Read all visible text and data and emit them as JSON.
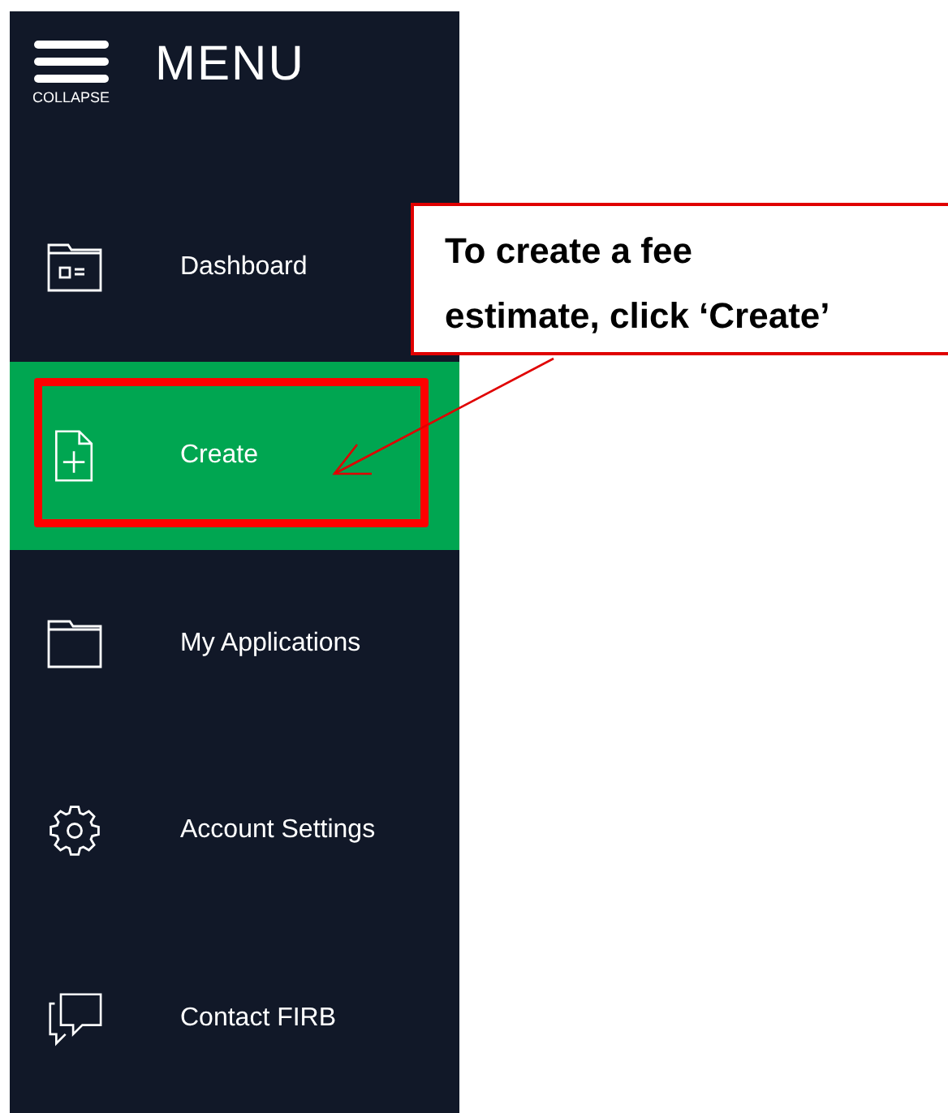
{
  "sidebar": {
    "collapse_label": "COLLAPSE",
    "title": "MENU",
    "items": [
      {
        "kind": "dashboard",
        "label": "Dashboard",
        "selected": false
      },
      {
        "kind": "create",
        "label": "Create",
        "selected": true
      },
      {
        "kind": "applications",
        "label": "My Applications",
        "selected": false
      },
      {
        "kind": "settings",
        "label": "Account Settings",
        "selected": false
      },
      {
        "kind": "contact",
        "label": "Contact FIRB",
        "selected": false
      }
    ]
  },
  "callout": {
    "text": "To create a fee estimate, click ‘Create’"
  }
}
